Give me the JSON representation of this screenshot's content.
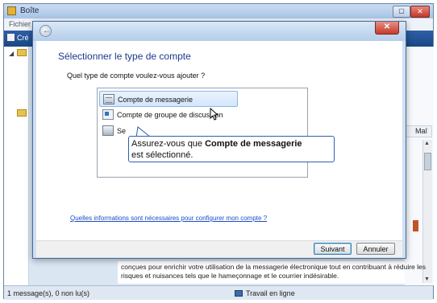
{
  "background_window": {
    "title": "Boîte",
    "menu_fichier": "Fichier",
    "new_button": "Cré",
    "column_header": "Maî",
    "preview_line1": "conçues pour enrichir votre utilisation de la messagerie électronique tout en contribuant à réduire les",
    "preview_line2": "risques et nuisances tels que le hameçonnage et le courrier indésirable.",
    "status_count": "1 message(s), 0 non lu(s)",
    "status_online": "Travail en ligne"
  },
  "dialog": {
    "back_icon": "back-arrow-icon",
    "close_label": "✕",
    "heading": "Sélectionner le type de compte",
    "question": "Quel type de compte voulez-vous ajouter ?",
    "account_types": [
      {
        "label": "Compte de messagerie",
        "icon": "mail-icon",
        "selected": true
      },
      {
        "label": "Compte de groupe de discussion",
        "icon": "newsgroup-icon"
      },
      {
        "label": "Se",
        "icon": "directory-icon"
      }
    ],
    "callout": {
      "prefix": "Assurez-vous que ",
      "bold": "Compte de messagerie",
      "line2": "est sélectionné."
    },
    "help_link": "Quelles informations sont nécessaires pour configurer mon compte ?",
    "buttons": {
      "next": "Suivant",
      "cancel": "Annuler"
    }
  },
  "colors": {
    "heading": "#1c3a8c",
    "link": "#1a4ec5",
    "callout_border": "#2f5fb0",
    "close": "#c33b2c"
  }
}
